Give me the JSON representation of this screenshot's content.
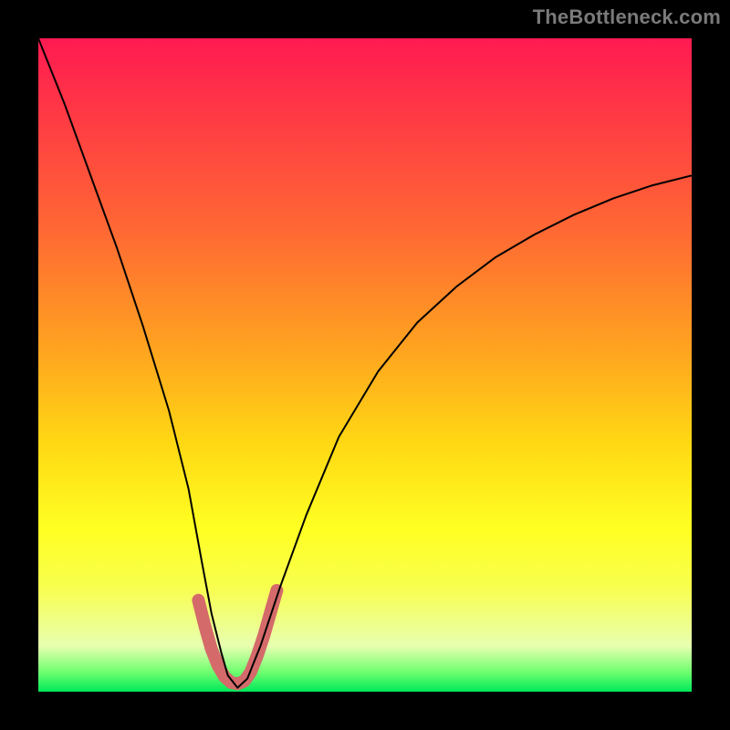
{
  "watermark": "TheBottleneck.com",
  "chart_data": {
    "type": "line",
    "title": "",
    "xlabel": "",
    "ylabel": "",
    "xlim": [
      0,
      100
    ],
    "ylim": [
      0,
      100
    ],
    "series": [
      {
        "name": "curve",
        "color": "#000000",
        "stroke_width": 2,
        "x": [
          0,
          4,
          8,
          12,
          16,
          20,
          23,
          25,
          26.5,
          28,
          29,
          30.5,
          32,
          34,
          37,
          41,
          46,
          52,
          58,
          64,
          70,
          76,
          82,
          88,
          94,
          100
        ],
        "y": [
          100,
          90,
          79,
          68,
          56,
          43,
          31,
          20,
          12,
          6,
          2.5,
          0.6,
          2,
          7,
          16,
          27,
          39,
          49,
          56.5,
          62,
          66.5,
          70,
          73,
          75.5,
          77.5,
          79
        ]
      },
      {
        "name": "highlight",
        "color": "#d46a6a",
        "stroke_width": 14,
        "linecap": "round",
        "x": [
          24.5,
          25.5,
          26.5,
          27.5,
          28.5,
          29.5,
          30.5,
          31.5,
          32.5,
          33.5,
          34.5,
          35.5,
          36.5
        ],
        "y": [
          14,
          10,
          6.5,
          4,
          2.3,
          1.4,
          1.2,
          1.6,
          3,
          5.5,
          8.5,
          12,
          15.5
        ]
      }
    ],
    "background_gradient": {
      "stops": [
        {
          "pos": 0.0,
          "color": "#ff1a52"
        },
        {
          "pos": 0.12,
          "color": "#ff3a44"
        },
        {
          "pos": 0.3,
          "color": "#ff6a33"
        },
        {
          "pos": 0.48,
          "color": "#ffa51f"
        },
        {
          "pos": 0.62,
          "color": "#ffd814"
        },
        {
          "pos": 0.75,
          "color": "#ffff22"
        },
        {
          "pos": 0.84,
          "color": "#f8ff4e"
        },
        {
          "pos": 0.93,
          "color": "#e8ffb0"
        },
        {
          "pos": 0.97,
          "color": "#6fff6f"
        },
        {
          "pos": 1.0,
          "color": "#00e85a"
        }
      ]
    }
  }
}
